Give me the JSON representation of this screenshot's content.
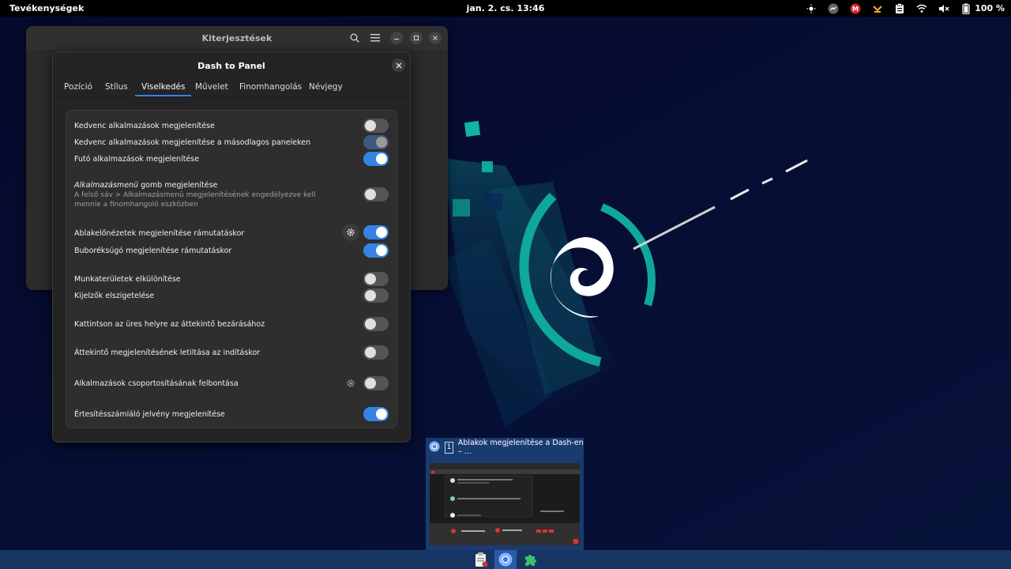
{
  "topbar": {
    "activities": "Tevékenységek",
    "clock": "jan. 2. cs.  13:46",
    "battery": "100 %",
    "tray_icons": [
      "brightness-icon",
      "messenger-icon",
      "mega-icon",
      "update-icon",
      "clipboard-icon",
      "wifi-icon",
      "volume-muted-icon",
      "battery-icon"
    ]
  },
  "ext_window": {
    "title": "Kiterjesztések"
  },
  "dialog": {
    "title": "Dash to Panel",
    "tabs": [
      "Pozíció",
      "Stílus",
      "Viselkedés",
      "Művelet",
      "Finomhangolás",
      "Névjegy"
    ],
    "active_tab": "Viselkedés",
    "rows": {
      "fav": "Kedvenc alkalmazások megjelenítése",
      "fav_secondary": "Kedvenc alkalmazások megjelenítése a másodlagos paneleken",
      "running": "Futó alkalmazások megjelenítése",
      "appmenu_italic": "Alkalmazásmenü",
      "appmenu_rest": " gomb megjelenítése",
      "appmenu_sub": "A felső sáv > Alkalmazásmenü megjelenítésének engedélyezve kell mennie a finomhangoló eszközben",
      "previews": "Ablakelőnézetek megjelenítése rámutatáskor",
      "tooltip": "Buboréksúgó megjelenítése rámutatáskor",
      "isolate_ws": "Munkaterületek elkülönítése",
      "isolate_mon": "Kijelzők elszigetelése",
      "click_empty": "Kattintson az üres helyre az áttekintő bezárásához",
      "disable_overview": "Áttekintő megjelenítésének letiltása az indításkor",
      "ungroup": "Alkalmazások csoportosításának felbontása",
      "badge": "Értesítésszámláló jelvény megjelenítése"
    },
    "toggles": {
      "fav": false,
      "fav_secondary": "disabled-on",
      "running": true,
      "appmenu": false,
      "previews": true,
      "tooltip": true,
      "isolate_ws": false,
      "isolate_mon": false,
      "click_empty": false,
      "disable_overview": false,
      "ungroup": false,
      "badge": true
    }
  },
  "preview": {
    "number": "1",
    "title": "Ablakok megjelenítése a Dash-en – ..."
  },
  "taskbar": {
    "apps": [
      "text-editor-icon",
      "chromium-icon",
      "extensions-icon"
    ]
  },
  "colors": {
    "accent": "#3584e4",
    "teal": "#0fa89a",
    "desktop": "#050a2c",
    "taskbar": "#173563"
  }
}
